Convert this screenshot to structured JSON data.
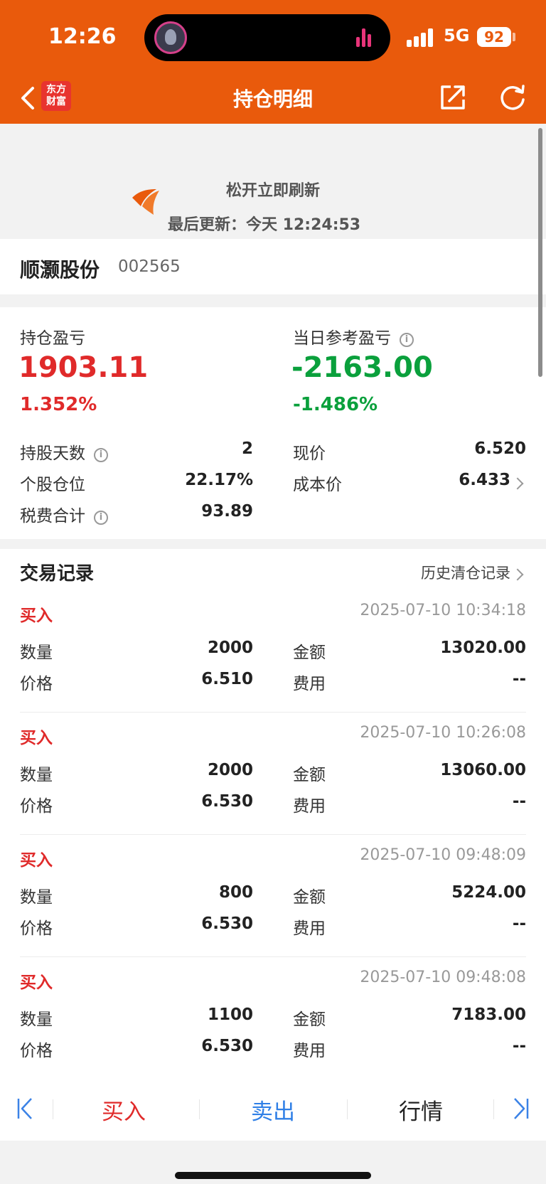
{
  "status": {
    "time": "12:26",
    "network": "5G",
    "battery": "92"
  },
  "header": {
    "logo_line1": "东方",
    "logo_line2": "财富",
    "title": "持仓明细"
  },
  "pull": {
    "hint": "松开立即刷新",
    "updated": "最后更新：今天 12:24:53"
  },
  "stock": {
    "name": "顺灏股份",
    "code": "002565"
  },
  "summary": {
    "holding_pl_label": "持仓盈亏",
    "holding_pl": "1903.11",
    "holding_pl_pct": "1.352%",
    "daily_pl_label": "当日参考盈亏",
    "daily_pl": "-2163.00",
    "daily_pl_pct": "-1.486%",
    "rows": [
      {
        "l_label": "持股天数",
        "l_value": "2",
        "r_label": "现价",
        "r_value": "6.520"
      },
      {
        "l_label": "个股仓位",
        "l_value": "22.17%",
        "r_label": "成本价",
        "r_value": "6.433"
      },
      {
        "l_label": "税费合计",
        "l_value": "93.89"
      }
    ],
    "colors": {
      "up": "#e02a2a",
      "down": "#0aa03c"
    }
  },
  "trades": {
    "title": "交易记录",
    "history_link": "历史清仓记录",
    "qty_label": "数量",
    "price_label": "价格",
    "amount_label": "金额",
    "fee_label": "费用",
    "records": [
      {
        "type": "买入",
        "time": "2025-07-10 10:34:18",
        "qty": "2000",
        "price": "6.510",
        "amount": "13020.00",
        "fee": "--"
      },
      {
        "type": "买入",
        "time": "2025-07-10 10:26:08",
        "qty": "2000",
        "price": "6.530",
        "amount": "13060.00",
        "fee": "--"
      },
      {
        "type": "买入",
        "time": "2025-07-10 09:48:09",
        "qty": "800",
        "price": "6.530",
        "amount": "5224.00",
        "fee": "--"
      },
      {
        "type": "买入",
        "time": "2025-07-10 09:48:08",
        "qty": "1100",
        "price": "6.530",
        "amount": "7183.00",
        "fee": "--"
      }
    ]
  },
  "bottom": {
    "buy": "买入",
    "sell": "卖出",
    "quote": "行情"
  },
  "brand_color": "#e95a0c"
}
